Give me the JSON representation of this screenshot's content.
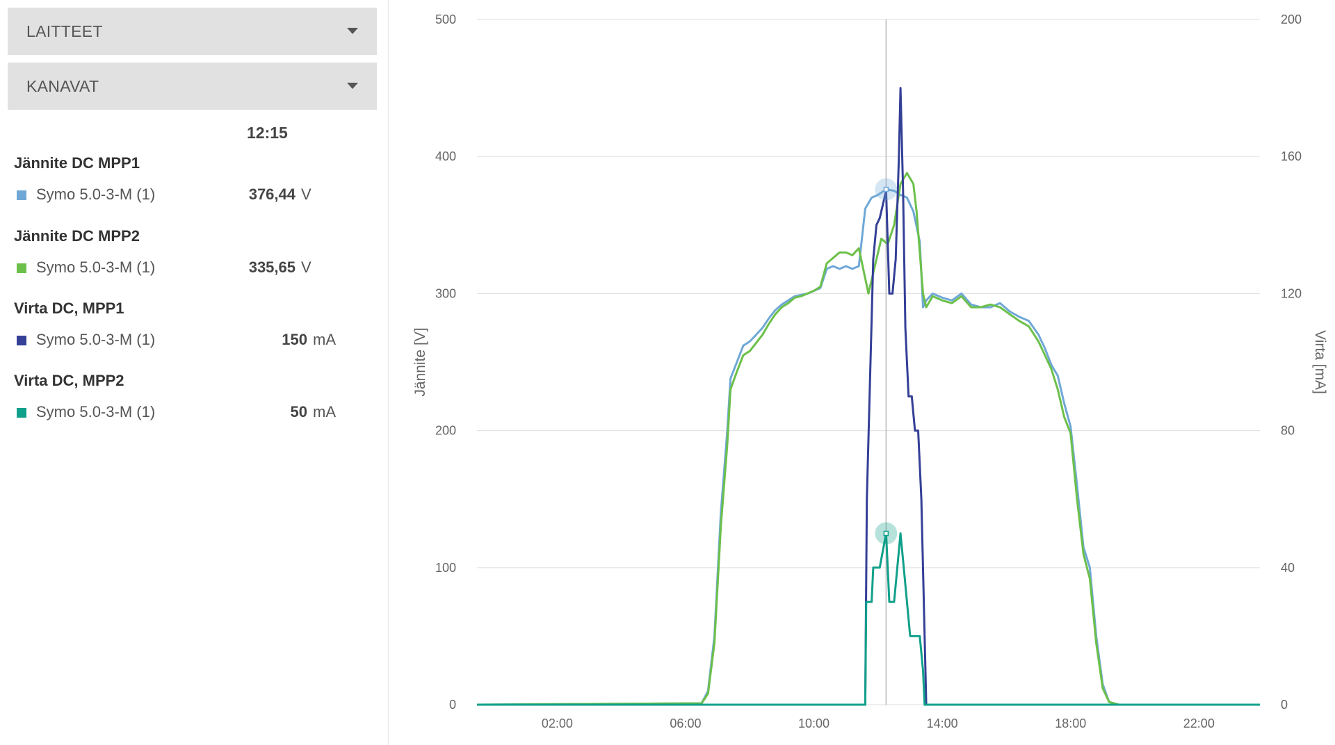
{
  "panel": {
    "devices_label": "LAITTEET",
    "channels_label": "KANAVAT",
    "time": "12:15"
  },
  "legend_groups": [
    {
      "title": "Jännite DC MPP1",
      "device": "Symo 5.0-3-M (1)",
      "value": "376,44",
      "unit": "V",
      "color": "#6fa8d6"
    },
    {
      "title": "Jännite DC MPP2",
      "device": "Symo 5.0-3-M (1)",
      "value": "335,65",
      "unit": "V",
      "color": "#6cc04a"
    },
    {
      "title": "Virta DC, MPP1",
      "device": "Symo 5.0-3-M (1)",
      "value": "150",
      "unit": "mA",
      "color": "#343f96"
    },
    {
      "title": "Virta DC, MPP2",
      "device": "Symo 5.0-3-M (1)",
      "value": "50",
      "unit": "mA",
      "color": "#11a08a"
    }
  ],
  "chart_data": {
    "type": "line",
    "x_unit": "hour of day",
    "xlim": [
      -0.5,
      23.9
    ],
    "xticks": [
      2,
      6,
      10,
      14,
      18,
      22
    ],
    "xtick_labels": [
      "02:00",
      "06:00",
      "10:00",
      "14:00",
      "18:00",
      "22:00"
    ],
    "ylabel": "Jännite [V]",
    "ylim": [
      0,
      500
    ],
    "yticks": [
      0,
      100,
      200,
      300,
      400,
      500
    ],
    "y2label": "Virta [mA]",
    "y2lim": [
      0,
      200
    ],
    "y2ticks": [
      0,
      40,
      80,
      120,
      160,
      200
    ],
    "grid": true,
    "cursor_x": 12.25,
    "series": [
      {
        "name": "Jännite DC MPP1",
        "axis": "left",
        "color": "#6fa8d6",
        "points": [
          [
            -0.5,
            0
          ],
          [
            6.5,
            1
          ],
          [
            6.7,
            10
          ],
          [
            6.9,
            50
          ],
          [
            7.1,
            140
          ],
          [
            7.3,
            200
          ],
          [
            7.4,
            238
          ],
          [
            7.6,
            250
          ],
          [
            7.8,
            262
          ],
          [
            8.0,
            265
          ],
          [
            8.2,
            270
          ],
          [
            8.4,
            275
          ],
          [
            8.6,
            282
          ],
          [
            8.8,
            288
          ],
          [
            9.0,
            292
          ],
          [
            9.2,
            295
          ],
          [
            9.4,
            298
          ],
          [
            9.6,
            299
          ],
          [
            9.8,
            300
          ],
          [
            10.0,
            302
          ],
          [
            10.2,
            304
          ],
          [
            10.4,
            318
          ],
          [
            10.6,
            320
          ],
          [
            10.8,
            318
          ],
          [
            11.0,
            320
          ],
          [
            11.2,
            318
          ],
          [
            11.4,
            320
          ],
          [
            11.6,
            362
          ],
          [
            11.8,
            370
          ],
          [
            12.0,
            372
          ],
          [
            12.25,
            376
          ],
          [
            12.5,
            375
          ],
          [
            12.7,
            372
          ],
          [
            12.9,
            370
          ],
          [
            13.1,
            360
          ],
          [
            13.3,
            338
          ],
          [
            13.4,
            290
          ],
          [
            13.5,
            295
          ],
          [
            13.7,
            300
          ],
          [
            14.0,
            297
          ],
          [
            14.3,
            295
          ],
          [
            14.6,
            300
          ],
          [
            14.9,
            292
          ],
          [
            15.2,
            290
          ],
          [
            15.5,
            290
          ],
          [
            15.8,
            293
          ],
          [
            16.1,
            287
          ],
          [
            16.4,
            283
          ],
          [
            16.7,
            280
          ],
          [
            17.0,
            270
          ],
          [
            17.2,
            260
          ],
          [
            17.4,
            248
          ],
          [
            17.6,
            240
          ],
          [
            17.8,
            220
          ],
          [
            18.0,
            203
          ],
          [
            18.2,
            160
          ],
          [
            18.4,
            115
          ],
          [
            18.6,
            100
          ],
          [
            18.8,
            50
          ],
          [
            19.0,
            15
          ],
          [
            19.2,
            2
          ],
          [
            19.5,
            0
          ],
          [
            23.9,
            0
          ]
        ]
      },
      {
        "name": "Jännite DC MPP2",
        "axis": "left",
        "color": "#6cc04a",
        "points": [
          [
            -0.5,
            0
          ],
          [
            6.5,
            1
          ],
          [
            6.7,
            8
          ],
          [
            6.9,
            45
          ],
          [
            7.1,
            130
          ],
          [
            7.3,
            190
          ],
          [
            7.4,
            230
          ],
          [
            7.6,
            243
          ],
          [
            7.8,
            255
          ],
          [
            8.0,
            258
          ],
          [
            8.2,
            264
          ],
          [
            8.4,
            270
          ],
          [
            8.6,
            278
          ],
          [
            8.8,
            285
          ],
          [
            9.0,
            290
          ],
          [
            9.2,
            293
          ],
          [
            9.4,
            297
          ],
          [
            9.6,
            298
          ],
          [
            9.8,
            300
          ],
          [
            10.0,
            302
          ],
          [
            10.2,
            305
          ],
          [
            10.4,
            322
          ],
          [
            10.6,
            326
          ],
          [
            10.8,
            330
          ],
          [
            11.0,
            330
          ],
          [
            11.2,
            328
          ],
          [
            11.4,
            333
          ],
          [
            11.7,
            300
          ],
          [
            11.9,
            320
          ],
          [
            12.1,
            340
          ],
          [
            12.3,
            336
          ],
          [
            12.5,
            350
          ],
          [
            12.7,
            380
          ],
          [
            12.9,
            388
          ],
          [
            13.1,
            380
          ],
          [
            13.2,
            360
          ],
          [
            13.4,
            300
          ],
          [
            13.5,
            290
          ],
          [
            13.7,
            298
          ],
          [
            14.0,
            295
          ],
          [
            14.3,
            293
          ],
          [
            14.6,
            298
          ],
          [
            14.9,
            290
          ],
          [
            15.2,
            290
          ],
          [
            15.5,
            292
          ],
          [
            15.8,
            290
          ],
          [
            16.1,
            285
          ],
          [
            16.4,
            280
          ],
          [
            16.7,
            276
          ],
          [
            17.0,
            265
          ],
          [
            17.2,
            255
          ],
          [
            17.4,
            245
          ],
          [
            17.6,
            230
          ],
          [
            17.8,
            210
          ],
          [
            18.0,
            198
          ],
          [
            18.2,
            150
          ],
          [
            18.4,
            110
          ],
          [
            18.6,
            92
          ],
          [
            18.8,
            45
          ],
          [
            19.0,
            12
          ],
          [
            19.2,
            2
          ],
          [
            19.5,
            0
          ],
          [
            23.9,
            0
          ]
        ]
      },
      {
        "name": "Virta DC, MPP1",
        "axis": "right",
        "color": "#343f96",
        "points": [
          [
            -0.5,
            0
          ],
          [
            11.6,
            0
          ],
          [
            11.65,
            60
          ],
          [
            11.75,
            95
          ],
          [
            11.85,
            130
          ],
          [
            11.95,
            140
          ],
          [
            12.05,
            142
          ],
          [
            12.25,
            150
          ],
          [
            12.35,
            120
          ],
          [
            12.45,
            120
          ],
          [
            12.55,
            130
          ],
          [
            12.65,
            160
          ],
          [
            12.7,
            180
          ],
          [
            12.78,
            150
          ],
          [
            12.85,
            110
          ],
          [
            12.95,
            90
          ],
          [
            13.05,
            90
          ],
          [
            13.15,
            80
          ],
          [
            13.25,
            80
          ],
          [
            13.35,
            60
          ],
          [
            13.45,
            20
          ],
          [
            13.5,
            0
          ],
          [
            23.9,
            0
          ]
        ]
      },
      {
        "name": "Virta DC, MPP2",
        "axis": "right",
        "color": "#11a08a",
        "points": [
          [
            -0.5,
            0
          ],
          [
            11.6,
            0
          ],
          [
            11.63,
            30
          ],
          [
            11.8,
            30
          ],
          [
            11.85,
            40
          ],
          [
            12.05,
            40
          ],
          [
            12.25,
            50
          ],
          [
            12.35,
            30
          ],
          [
            12.5,
            30
          ],
          [
            12.7,
            50
          ],
          [
            12.8,
            40
          ],
          [
            12.9,
            30
          ],
          [
            13.0,
            20
          ],
          [
            13.3,
            20
          ],
          [
            13.4,
            10
          ],
          [
            13.45,
            0
          ],
          [
            23.9,
            0
          ]
        ]
      }
    ]
  }
}
